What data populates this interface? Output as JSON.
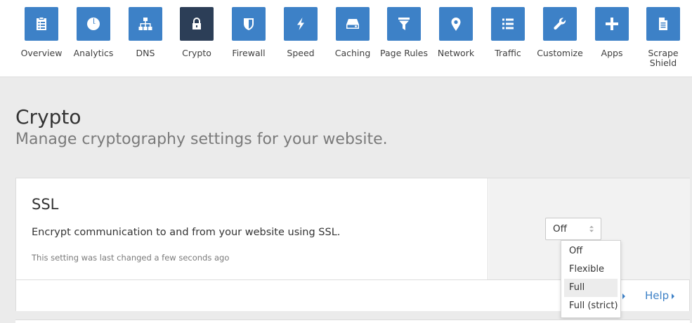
{
  "nav": {
    "items": [
      {
        "label": "Overview",
        "icon": "clipboard-list-icon"
      },
      {
        "label": "Analytics",
        "icon": "pie-chart-icon"
      },
      {
        "label": "DNS",
        "icon": "sitemap-icon"
      },
      {
        "label": "Crypto",
        "icon": "lock-icon",
        "active": true
      },
      {
        "label": "Firewall",
        "icon": "shield-icon"
      },
      {
        "label": "Speed",
        "icon": "lightning-bolt-icon"
      },
      {
        "label": "Caching",
        "icon": "hard-drive-icon"
      },
      {
        "label": "Page Rules",
        "icon": "filter-funnel-icon"
      },
      {
        "label": "Network",
        "icon": "map-pin-icon"
      },
      {
        "label": "Traffic",
        "icon": "list-icon"
      },
      {
        "label": "Customize",
        "icon": "wrench-icon"
      },
      {
        "label": "Apps",
        "icon": "plus-icon"
      },
      {
        "label": "Scrape\nShield",
        "icon": "document-icon"
      }
    ]
  },
  "page": {
    "title": "Crypto",
    "subtitle": "Manage cryptography settings for your website."
  },
  "ssl": {
    "title": "SSL",
    "description": "Encrypt communication to and from your website using SSL.",
    "last_changed": "This setting was last changed a few seconds ago",
    "selected": "Off",
    "options": [
      "Off",
      "Flexible",
      "Full",
      "Full (strict)"
    ],
    "hovered_option": "Full",
    "help_label": "Help"
  },
  "colors": {
    "tile": "#3d81c7",
    "tile_active": "#2c3e57",
    "link": "#3d81c7"
  }
}
